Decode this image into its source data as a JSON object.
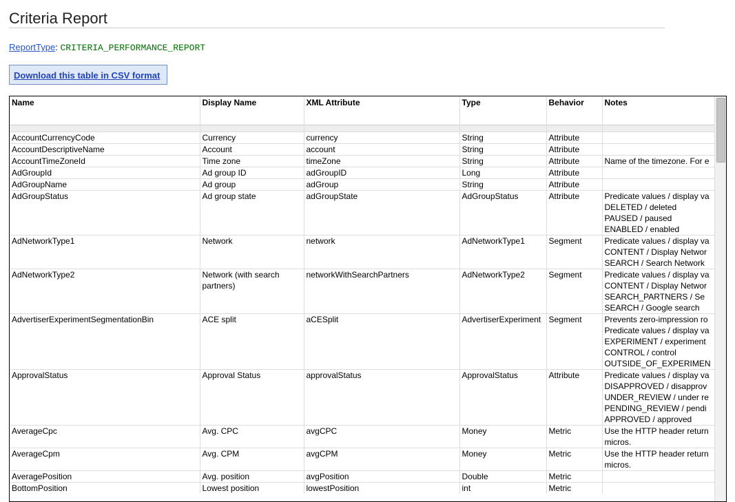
{
  "page": {
    "title": "Criteria Report",
    "report_type_label": "ReportType",
    "report_type_value": "CRITERIA_PERFORMANCE_REPORT",
    "csv_link": "Download this table in CSV format"
  },
  "table": {
    "headers": [
      "Name",
      "Display Name",
      "XML Attribute",
      "Type",
      "Behavior",
      "Notes"
    ],
    "rows": [
      {
        "name": "AccountCurrencyCode",
        "display": "Currency",
        "xml": "currency",
        "type": "String",
        "behavior": "Attribute",
        "notes": []
      },
      {
        "name": "AccountDescriptiveName",
        "display": "Account",
        "xml": "account",
        "type": "String",
        "behavior": "Attribute",
        "notes": []
      },
      {
        "name": "AccountTimeZoneId",
        "display": "Time zone",
        "xml": "timeZone",
        "type": "String",
        "behavior": "Attribute",
        "notes": [
          "Name of the timezone. For e"
        ]
      },
      {
        "name": "AdGroupId",
        "display": "Ad group ID",
        "xml": "adGroupID",
        "type": "Long",
        "behavior": "Attribute",
        "notes": []
      },
      {
        "name": "AdGroupName",
        "display": "Ad group",
        "xml": "adGroup",
        "type": "String",
        "behavior": "Attribute",
        "notes": []
      },
      {
        "name": "AdGroupStatus",
        "display": "Ad group state",
        "xml": "adGroupState",
        "type": "AdGroupStatus",
        "behavior": "Attribute",
        "notes": [
          "Predicate values / display va",
          "DELETED / deleted",
          "PAUSED / paused",
          "ENABLED / enabled"
        ]
      },
      {
        "name": "AdNetworkType1",
        "display": "Network",
        "xml": "network",
        "type": "AdNetworkType1",
        "behavior": "Segment",
        "notes": [
          "Predicate values / display va",
          "CONTENT / Display Networ",
          "SEARCH / Search Network"
        ]
      },
      {
        "name": "AdNetworkType2",
        "display": "Network (with search partners)",
        "xml": "networkWithSearchPartners",
        "type": "AdNetworkType2",
        "behavior": "Segment",
        "notes": [
          "Predicate values / display va",
          "CONTENT / Display Networ",
          "SEARCH_PARTNERS / Se",
          "SEARCH / Google search"
        ]
      },
      {
        "name": "AdvertiserExperimentSegmentationBin",
        "display": "ACE split",
        "xml": "aCESplit",
        "type": "AdvertiserExperiment",
        "behavior": "Segment",
        "notes": [
          "Prevents zero-impression ro",
          "Predicate values / display va",
          "EXPERIMENT / experiment",
          "CONTROL / control",
          "OUTSIDE_OF_EXPERIMEN"
        ]
      },
      {
        "name": "ApprovalStatus",
        "display": "Approval Status",
        "xml": "approvalStatus",
        "type": "ApprovalStatus",
        "behavior": "Attribute",
        "notes": [
          "Predicate values / display va",
          "DISAPPROVED / disapprov",
          "UNDER_REVIEW / under re",
          "PENDING_REVIEW / pendi",
          "APPROVED / approved"
        ]
      },
      {
        "name": "AverageCpc",
        "display": "Avg. CPC",
        "xml": "avgCPC",
        "type": "Money",
        "behavior": "Metric",
        "notes": [
          "Use the HTTP header return",
          "micros."
        ]
      },
      {
        "name": "AverageCpm",
        "display": "Avg. CPM",
        "xml": "avgCPM",
        "type": "Money",
        "behavior": "Metric",
        "notes": [
          "Use the HTTP header return",
          "micros."
        ]
      },
      {
        "name": "AveragePosition",
        "display": "Avg. position",
        "xml": "avgPosition",
        "type": "Double",
        "behavior": "Metric",
        "notes": []
      },
      {
        "name": "BottomPosition",
        "display": "Lowest position",
        "xml": "lowestPosition",
        "type": "int",
        "behavior": "Metric",
        "notes": []
      }
    ]
  }
}
